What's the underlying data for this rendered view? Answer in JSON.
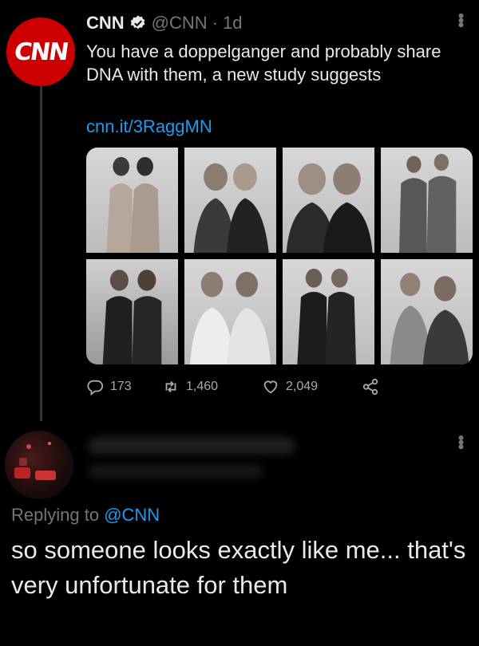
{
  "tweet": {
    "author_logo": "CNN",
    "author_name": "CNN",
    "author_handle": "@CNN",
    "separator": "·",
    "time": "1d",
    "text": "You have a doppelganger and probably share DNA with them, a new study suggests",
    "link": "cnn.it/3RaggMN",
    "media_count": 8,
    "actions": {
      "reply_count": "173",
      "retweet_count": "1,460",
      "like_count": "2,049"
    },
    "icons": [
      "verified-badge-icon",
      "more-icon",
      "reply-icon",
      "retweet-icon",
      "like-icon",
      "share-icon"
    ]
  },
  "reply": {
    "replying_label": "Replying to",
    "replying_handle": "@CNN",
    "text": "so someone looks exactly like me... that's very unfortunate for them"
  },
  "colors": {
    "background": "#000000",
    "text": "#e7e9ea",
    "muted": "#71767b",
    "link": "#1d9bf0",
    "cnn_red": "#cc0000"
  }
}
